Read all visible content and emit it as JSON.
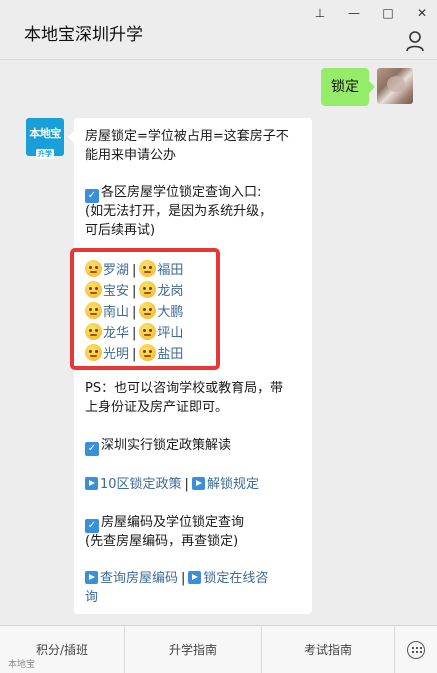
{
  "window_controls": {
    "pin": "⊥",
    "minimize": "—",
    "maximize": "□",
    "close": "✕"
  },
  "header": {
    "title": "本地宝深圳升学"
  },
  "outgoing": {
    "text": "锁定"
  },
  "bot_avatar": {
    "line1": "本地宝",
    "line2": "升学"
  },
  "message": {
    "intro1": "房屋锁定=学位被占用=这套房子不",
    "intro2": "能用来申请公办",
    "section1_title": "各区房屋学位锁定查询入口:",
    "note1": "(如无法打开，是因为系统升级，",
    "note2": "可后续再试)",
    "districts": [
      [
        "罗湖",
        "福田"
      ],
      [
        "宝安",
        "龙岗"
      ],
      [
        "南山",
        "大鹏"
      ],
      [
        "龙华",
        "坪山"
      ],
      [
        "光明",
        "盐田"
      ]
    ],
    "separator": "|",
    "ps1": "PS：也可以咨询学校或教育局，带",
    "ps2": "上身份证及房产证即可。",
    "section2_title": "深圳实行锁定政策解读",
    "link_policy": "10区锁定政策",
    "link_unlock": "解锁规定",
    "section3_title": "房屋编码及学位锁定查询",
    "note3": "(先查房屋编码，再查锁定)",
    "link_code": "查询房屋编码",
    "link_consult_a": "锁定在线咨",
    "link_consult_b": "询"
  },
  "menu": {
    "item1": "积分/插班",
    "item2": "升学指南",
    "item3": "考试指南"
  },
  "watermark": "本地宝",
  "colors": {
    "accent_link": "#3c6a9a",
    "bubble_green": "#95ec69",
    "highlight_border": "#e53935",
    "icon_blue": "#3a8fd9"
  }
}
